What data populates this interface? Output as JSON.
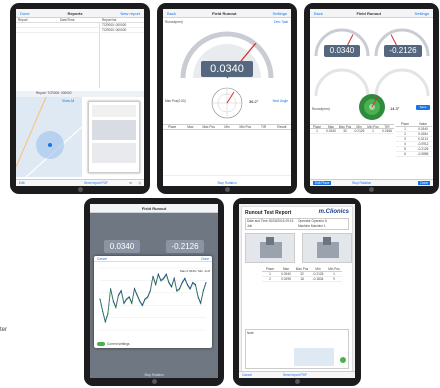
{
  "ipad1": {
    "nav": {
      "left": "Done",
      "title": "Reports",
      "right": "New report"
    },
    "filters": [
      "Report",
      "Date/Time",
      "Report list"
    ],
    "rows": [
      "TCR000: 000000",
      "TCR000: 000000"
    ],
    "map_caption": "Report: TCR000: 000000",
    "map_link": "Show All",
    "toolbar": {
      "left": "Edit",
      "mid": "Send report PDF"
    }
  },
  "ipad2": {
    "nav": {
      "left": "Back",
      "title": "Field Runout",
      "right": "Settings"
    },
    "gauge_label": "Runout(mm)",
    "gauge_link": "Zero Total",
    "gauge_value": "0.0340",
    "gauge_level": 0.72,
    "polar_label": "Max Pos(0.00)",
    "polar_angle": "36.2°",
    "polar_link": "Next Angle",
    "table_headers": [
      "Place",
      "Max",
      "Max Pos",
      "Min",
      "Min Pos",
      "TIR",
      "Result"
    ],
    "bottom": "Stop Rotation"
  },
  "ipad3": {
    "nav": {
      "left": "Back",
      "title": "Field Runout",
      "right": "Settings"
    },
    "gauges": [
      "0.0340",
      "-0.2126"
    ],
    "gauge_levels": [
      0.65,
      0.35
    ],
    "angle_label": "Runout(mm)",
    "angle": "14.3°",
    "button": "Save",
    "table_headers": [
      "Place",
      "Max",
      "Max Pos",
      "Min",
      "Min Pos",
      "TIR"
    ],
    "table_rows": [
      [
        "1",
        "0.0340",
        "32",
        "-0.2126",
        "1",
        "0.2466"
      ]
    ],
    "values_header": [
      "Place",
      "Value"
    ],
    "values": [
      [
        "1",
        "0.0340"
      ],
      [
        "2",
        "0.0284"
      ],
      [
        "3",
        "0.0213"
      ],
      [
        "4",
        "-0.0912"
      ],
      [
        "5",
        "-0.2126"
      ],
      [
        "6",
        "-0.0885"
      ]
    ],
    "toolbar": {
      "left": "Edit Place",
      "mid": "Stop Rotation",
      "right": "Done"
    }
  },
  "ipad4": {
    "nav": {
      "title": "Field Runout"
    },
    "gauges": [
      "0.0340",
      "-0.2126"
    ],
    "popup": {
      "left": "Cancel",
      "right": "Done",
      "legend": "Max 0.0340\nMin -0.2126"
    },
    "chart_data": {
      "type": "line",
      "title": "",
      "xlabel": "",
      "ylabel": "",
      "ylim": [
        -0.25,
        0.05
      ],
      "x": [
        0,
        1,
        2,
        3,
        4,
        5,
        6,
        7,
        8,
        9,
        10,
        11,
        12,
        13,
        14,
        15,
        16,
        17,
        18,
        19,
        20,
        21,
        22,
        23,
        24,
        25,
        26,
        27,
        28,
        29,
        30,
        31,
        32,
        33,
        34,
        35,
        36,
        37,
        38,
        39,
        40
      ],
      "series": [
        {
          "name": "",
          "values": [
            -0.1,
            -0.16,
            -0.21,
            -0.17,
            -0.05,
            -0.11,
            -0.14,
            -0.08,
            -0.06,
            -0.12,
            -0.1,
            -0.09,
            -0.12,
            -0.05,
            -0.08,
            -0.11,
            -0.13,
            -0.1,
            -0.09,
            -0.06,
            0.01,
            -0.03,
            0.02,
            -0.01,
            0.0,
            0.02,
            -0.02,
            -0.04,
            0.0,
            -0.06,
            -0.05,
            -0.02,
            0.0,
            -0.03,
            -0.05,
            -0.02,
            -0.03,
            -0.09,
            -0.12,
            -0.06,
            -0.02
          ]
        }
      ]
    },
    "toggle_label": "Current settings",
    "toolbar": "Stop Rotation"
  },
  "ipad5": {
    "title": "Runout Test Report",
    "logo": "m.Clionics",
    "info": [
      [
        "Date and Time",
        "30/05/2016 09:15"
      ],
      [
        "Operator",
        "Operator A"
      ],
      [
        "Job",
        ""
      ],
      [
        "Machine",
        "Machine 1"
      ]
    ],
    "table_headers": [
      "Place",
      "Max",
      "Max Pos",
      "Min",
      "Min Pos"
    ],
    "table_rows": [
      [
        "1",
        "0.0340",
        "32",
        "-0.2126",
        "1"
      ],
      [
        "2",
        "0.0295",
        "18",
        "-0.1834",
        "9"
      ]
    ],
    "notes_label": "Note",
    "toolbar": {
      "left": "Cancel",
      "mid": "Send report PDF"
    }
  },
  "side_text": "ter"
}
